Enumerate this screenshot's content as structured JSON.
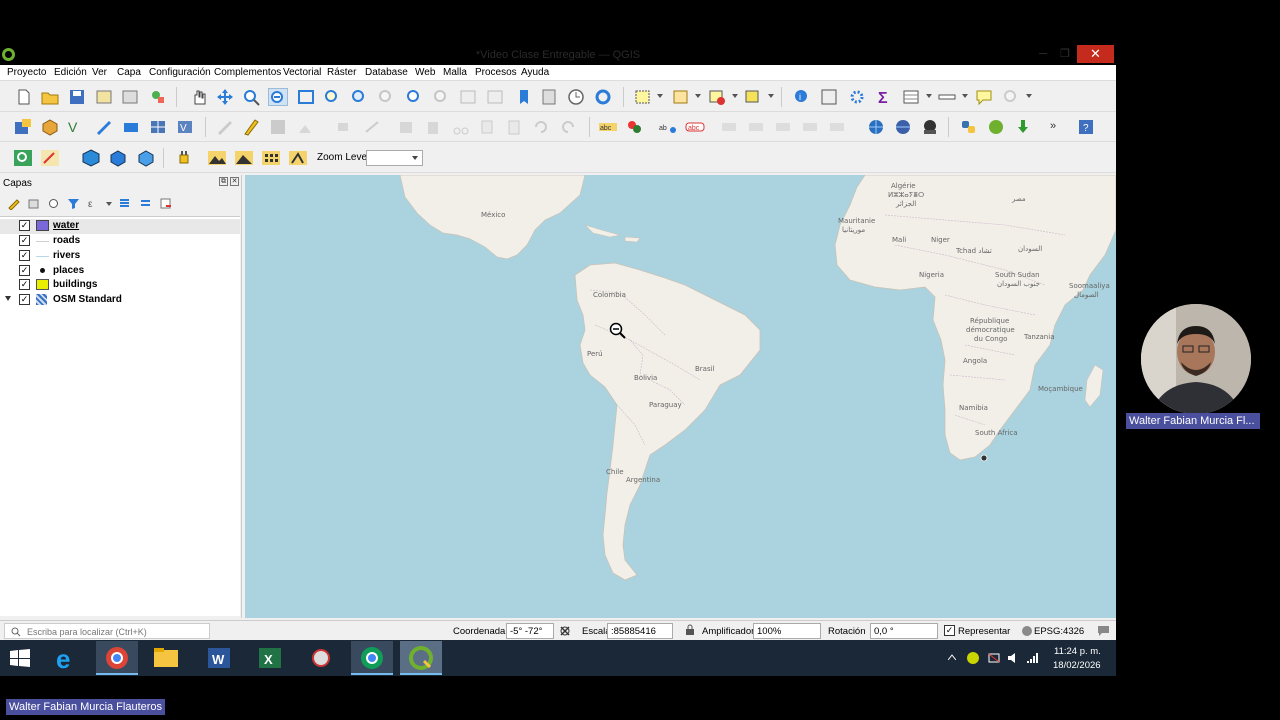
{
  "window": {
    "title": "*Video Clase Entregable — QGIS",
    "close_glyph": "✕",
    "min_glyph": "─",
    "max_glyph": "❐"
  },
  "menu": [
    "Proyecto",
    "Edición",
    "Ver",
    "Capa",
    "Configuración",
    "Complementos",
    "Vectorial",
    "Ráster",
    "Database",
    "Web",
    "Malla",
    "Procesos",
    "Ayuda"
  ],
  "toolbar": {
    "zoom_level_label": "Zoom Level:",
    "zoom_level_value": "",
    "more": "»"
  },
  "layers_panel": {
    "title": "Capas",
    "layers": [
      {
        "name": "water",
        "checked": true,
        "symbol": "fill",
        "color": "#7b68d8",
        "selected": true
      },
      {
        "name": "roads",
        "checked": true,
        "symbol": "line",
        "color": "#cfcfcf"
      },
      {
        "name": "rivers",
        "checked": true,
        "symbol": "line",
        "color": "#b9d8e8"
      },
      {
        "name": "places",
        "checked": true,
        "symbol": "point",
        "color": "#111111"
      },
      {
        "name": "buildings",
        "checked": true,
        "symbol": "fill",
        "color": "#e8f000"
      },
      {
        "name": "OSM Standard",
        "checked": true,
        "symbol": "raster",
        "color": "#3a6fc4",
        "expandable": true
      }
    ]
  },
  "map": {
    "water_color": "#aad3df",
    "land_color": "#f2efe9",
    "labels": {
      "mexico": "México",
      "colombia": "Colombia",
      "peru": "Perú",
      "brasil": "Brasil",
      "bolivia": "Bolivia",
      "paraguay": "Paraguay",
      "chile": "Chile",
      "argentina": "Argentina",
      "algerie": "Algérie",
      "algerie_ar": "ⵍⵣⵣⴰⵢⴻⵔ",
      "algerie_ar2": "الجزائر",
      "mauritanie": "Mauritanie",
      "mauritanie_ar": "موريتانيا",
      "mali": "Mali",
      "niger": "Niger",
      "tchad": "Tchad تشاد",
      "misr": "مصر",
      "sudan": "السودان",
      "nigeria": "Nigeria",
      "south_sudan": "South Sudan",
      "south_sudan_ar": "جنوب السودان",
      "somalia": "Soomaaliya",
      "somalia_ar": "الصومال",
      "rdc": "République",
      "rdc2": "démocratique",
      "rdc3": "du Congo",
      "tanzania": "Tanzania",
      "angola": "Angola",
      "mocambique": "Moçambique",
      "namibia": "Namibia",
      "south_africa": "South Africa"
    }
  },
  "statusbar": {
    "locator_placeholder": "Escriba para localizar (Ctrl+K)",
    "coord_label": "Coordenada",
    "coord_value": "-5° -72°",
    "scale_label": "Escala",
    "scale_value": ":85885416",
    "magnifier_label": "Amplificador",
    "magnifier_value": "100%",
    "rotation_label": "Rotación",
    "rotation_value": "0,0 °",
    "render_label": "Representar",
    "render_checked": true,
    "crs": "EPSG:4326"
  },
  "taskbar": {
    "time": "11:24 p. m.",
    "date": "18/02/2026"
  },
  "presenter": {
    "name_short": "Walter Fabian Murcia Fl...",
    "name_full": "Walter Fabian Murcia Flauteros"
  }
}
